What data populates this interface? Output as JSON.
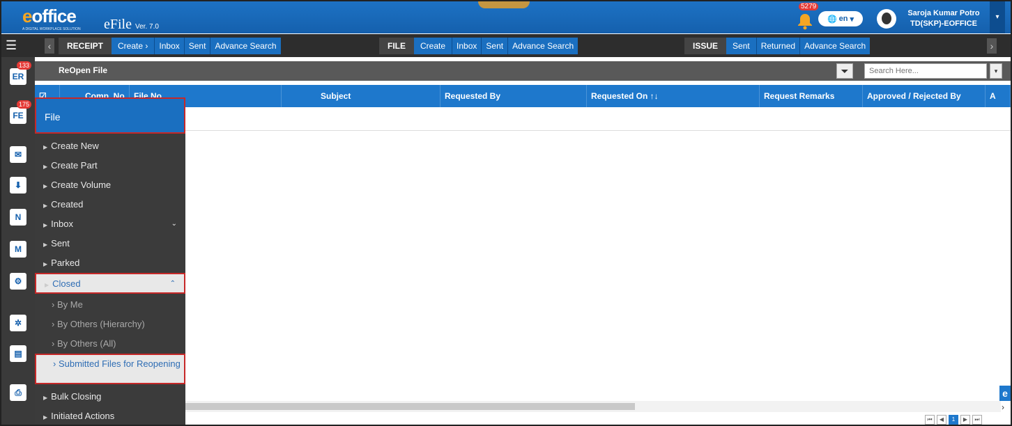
{
  "header": {
    "logo_prefix": "e",
    "logo_text": "office",
    "logo_tagline": "A DIGITAL WORKPLACE SOLUTION",
    "app_name": "eFile",
    "app_version": "Ver. 7.0",
    "notification_count": "5279",
    "language": "en",
    "user_name": "Saroja Kumar Potro",
    "user_role": "TD(SKP)-EOFFICE"
  },
  "menubar": {
    "receipt": {
      "label": "RECEIPT",
      "items": [
        "Create",
        "Inbox",
        "Sent",
        "Advance Search"
      ]
    },
    "file": {
      "label": "FILE",
      "items": [
        "Create",
        "Inbox",
        "Sent",
        "Advance Search"
      ]
    },
    "issue": {
      "label": "ISSUE",
      "items": [
        "Sent",
        "Returned",
        "Advance Search"
      ]
    }
  },
  "sidebar": {
    "receipt_badge": "133",
    "file_badge": "175"
  },
  "page": {
    "title": "ReOpen File",
    "search_placeholder": "Search Here..."
  },
  "table": {
    "columns": [
      "Comp. No. ↑↓",
      "File No.",
      "Subject",
      "Requested By",
      "Requested On ↑↓",
      "Request Remarks",
      "Approved / Rejected By",
      "A"
    ]
  },
  "flyout": {
    "title": "File",
    "items": [
      "Create New",
      "Create Part",
      "Create Volume",
      "Created",
      "Inbox",
      "Sent",
      "Parked",
      "Closed"
    ],
    "closed_subitems": [
      "By Me",
      "By Others (Hierarchy)",
      "By Others (All)",
      "Submitted Files for Reopening"
    ],
    "after_items": [
      "Bulk Closing",
      "Initiated Actions"
    ]
  },
  "pager": {
    "current_page": "1"
  }
}
